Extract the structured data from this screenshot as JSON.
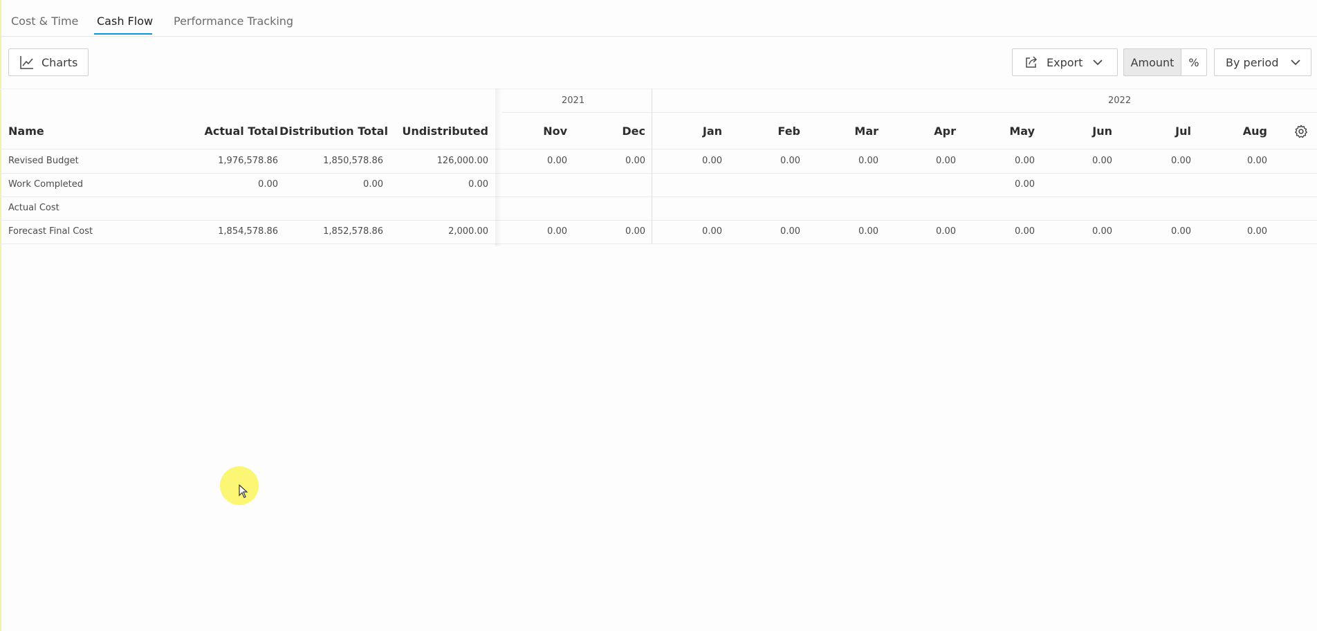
{
  "tabs": [
    {
      "label": "Cost & Time"
    },
    {
      "label": "Cash Flow",
      "active": true
    },
    {
      "label": "Performance Tracking"
    }
  ],
  "toolbar": {
    "charts_label": "Charts",
    "export_label": "Export",
    "amount_label": "Amount",
    "percent_label": "%",
    "period_label": "By period"
  },
  "table": {
    "years": [
      "2021",
      "2022"
    ],
    "headers": {
      "name": "Name",
      "actual_total": "Actual Total",
      "distribution_total": "Distribution Total",
      "undistributed": "Undistributed"
    },
    "months": [
      "Nov",
      "Dec",
      "Jan",
      "Feb",
      "Mar",
      "Apr",
      "May",
      "Jun",
      "Jul",
      "Aug"
    ],
    "rows": [
      {
        "name": "Revised Budget",
        "actual_total": "1,976,578.86",
        "distribution_total": "1,850,578.86",
        "undistributed": "126,000.00",
        "months": [
          "0.00",
          "0.00",
          "0.00",
          "0.00",
          "0.00",
          "0.00",
          "0.00",
          "0.00",
          "0.00",
          "0.00"
        ]
      },
      {
        "name": "Work Completed",
        "actual_total": "0.00",
        "distribution_total": "0.00",
        "undistributed": "0.00",
        "months": [
          "",
          "",
          "",
          "",
          "",
          "",
          "0.00",
          "",
          "",
          ""
        ]
      },
      {
        "name": "Actual Cost",
        "actual_total": "",
        "distribution_total": "",
        "undistributed": "",
        "months": [
          "",
          "",
          "",
          "",
          "",
          "",
          "",
          "",
          "",
          ""
        ]
      },
      {
        "name": "Forecast Final Cost",
        "actual_total": "1,854,578.86",
        "distribution_total": "1,852,578.86",
        "undistributed": "2,000.00",
        "months": [
          "0.00",
          "0.00",
          "0.00",
          "0.00",
          "0.00",
          "0.00",
          "0.00",
          "0.00",
          "0.00",
          "0.00"
        ]
      }
    ]
  },
  "icons": {
    "charts": "line-chart-icon",
    "export": "share-export-icon",
    "chevron": "chevron-down-icon",
    "settings": "gear-icon",
    "cursor": "mouse-pointer-icon"
  }
}
